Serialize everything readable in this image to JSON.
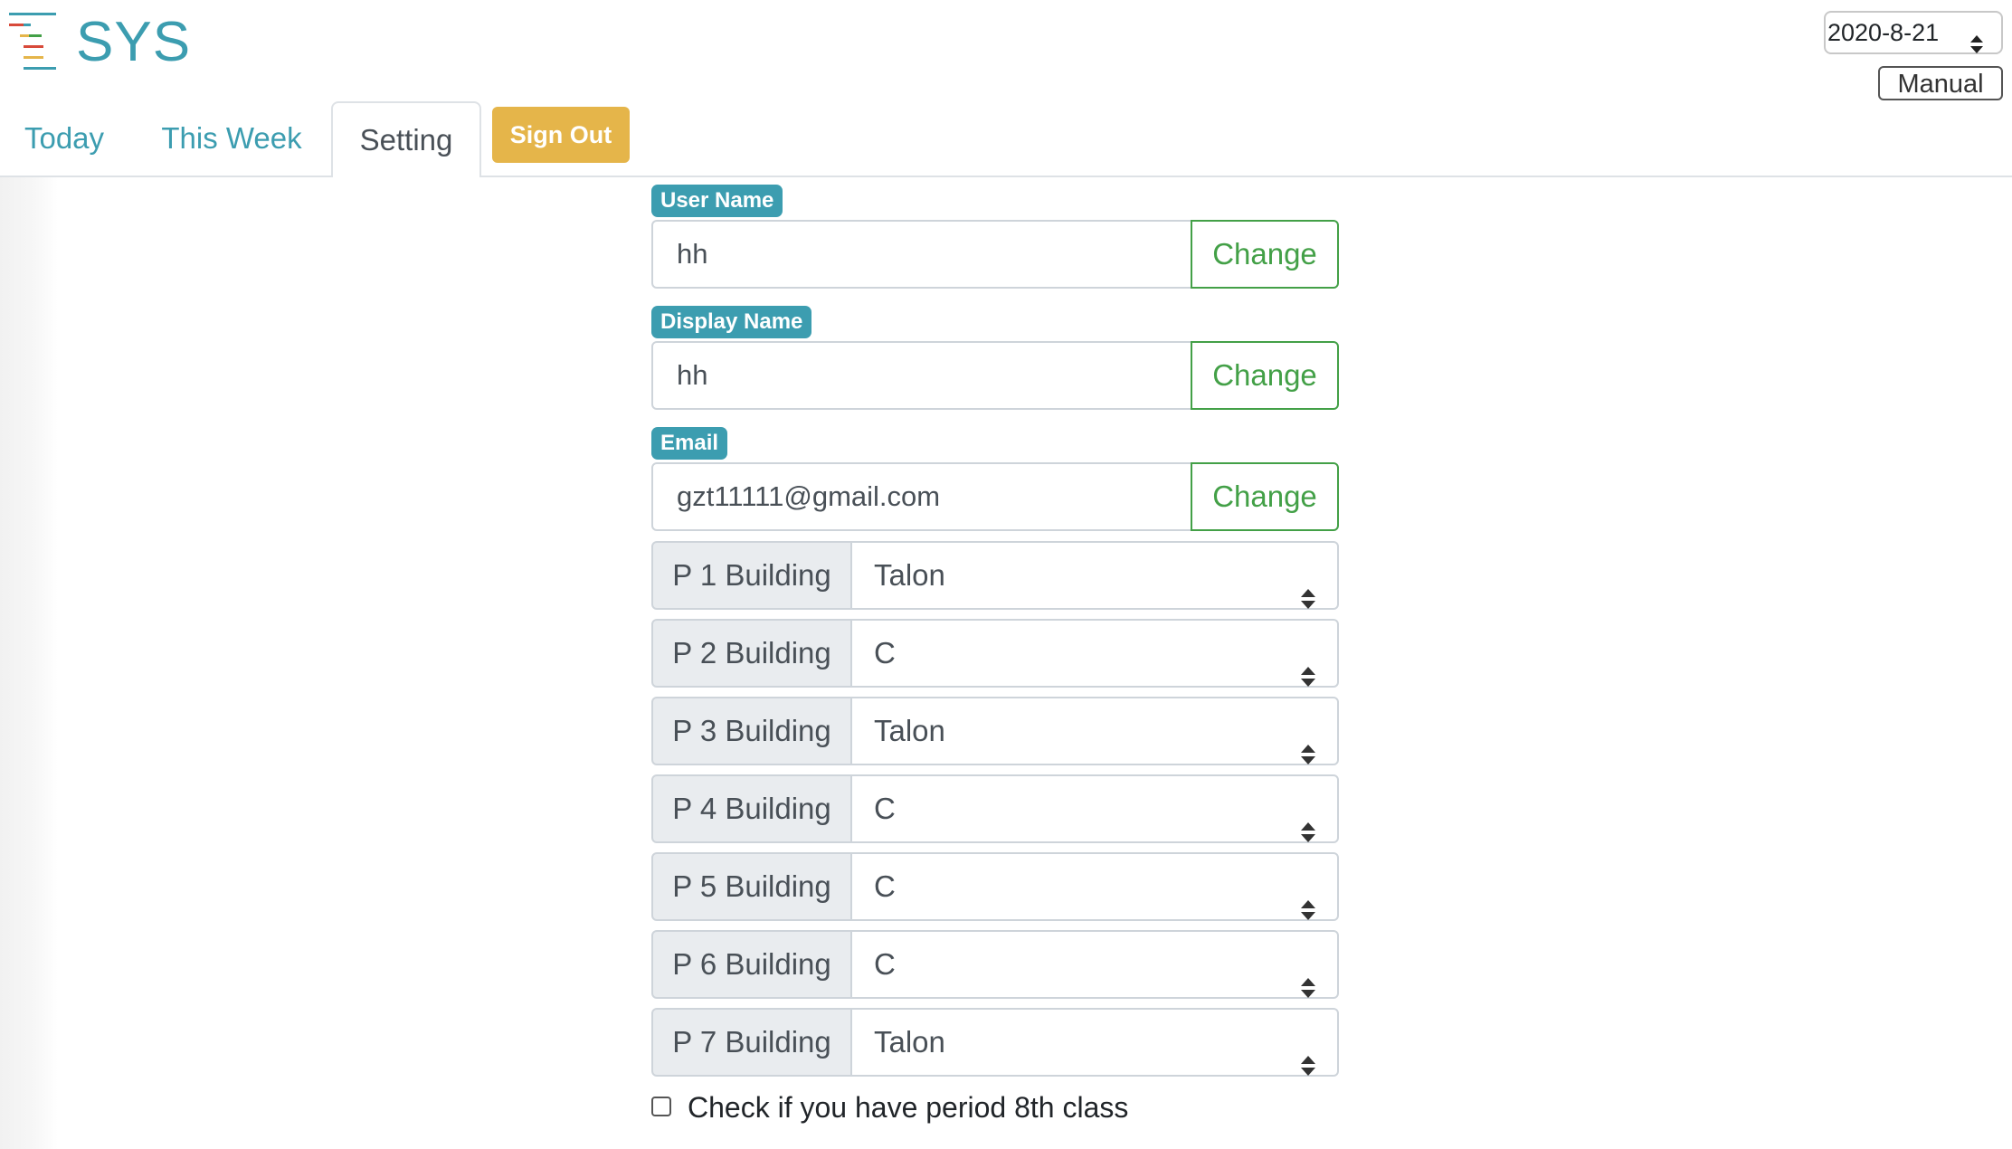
{
  "header": {
    "brand": "SYS",
    "date_value": "2020-8-21",
    "manual_label": "Manual"
  },
  "tabs": [
    {
      "label": "Today",
      "active": false
    },
    {
      "label": "This Week",
      "active": false
    },
    {
      "label": "Setting",
      "active": true
    }
  ],
  "signout_label": "Sign Out",
  "colors": {
    "brand": "#3c9db0",
    "signout": "#e5b54a",
    "change": "#43a047"
  },
  "icons": {
    "logo": "menu-lines-icon",
    "select_arrows": "sort-arrows-icon"
  },
  "fields": [
    {
      "label": "User Name",
      "value": "hh",
      "button": "Change"
    },
    {
      "label": "Display Name",
      "value": "hh",
      "button": "Change"
    },
    {
      "label": "Email",
      "value": "gzt11111@gmail.com",
      "button": "Change"
    }
  ],
  "buildings": [
    {
      "label": "P 1 Building",
      "value": "Talon"
    },
    {
      "label": "P 2 Building",
      "value": "C"
    },
    {
      "label": "P 3 Building",
      "value": "Talon"
    },
    {
      "label": "P 4 Building",
      "value": "C"
    },
    {
      "label": "P 5 Building",
      "value": "C"
    },
    {
      "label": "P 6 Building",
      "value": "C"
    },
    {
      "label": "P 7 Building",
      "value": "Talon"
    }
  ],
  "period8": {
    "label": "Check if you have period 8th class",
    "checked": false
  }
}
